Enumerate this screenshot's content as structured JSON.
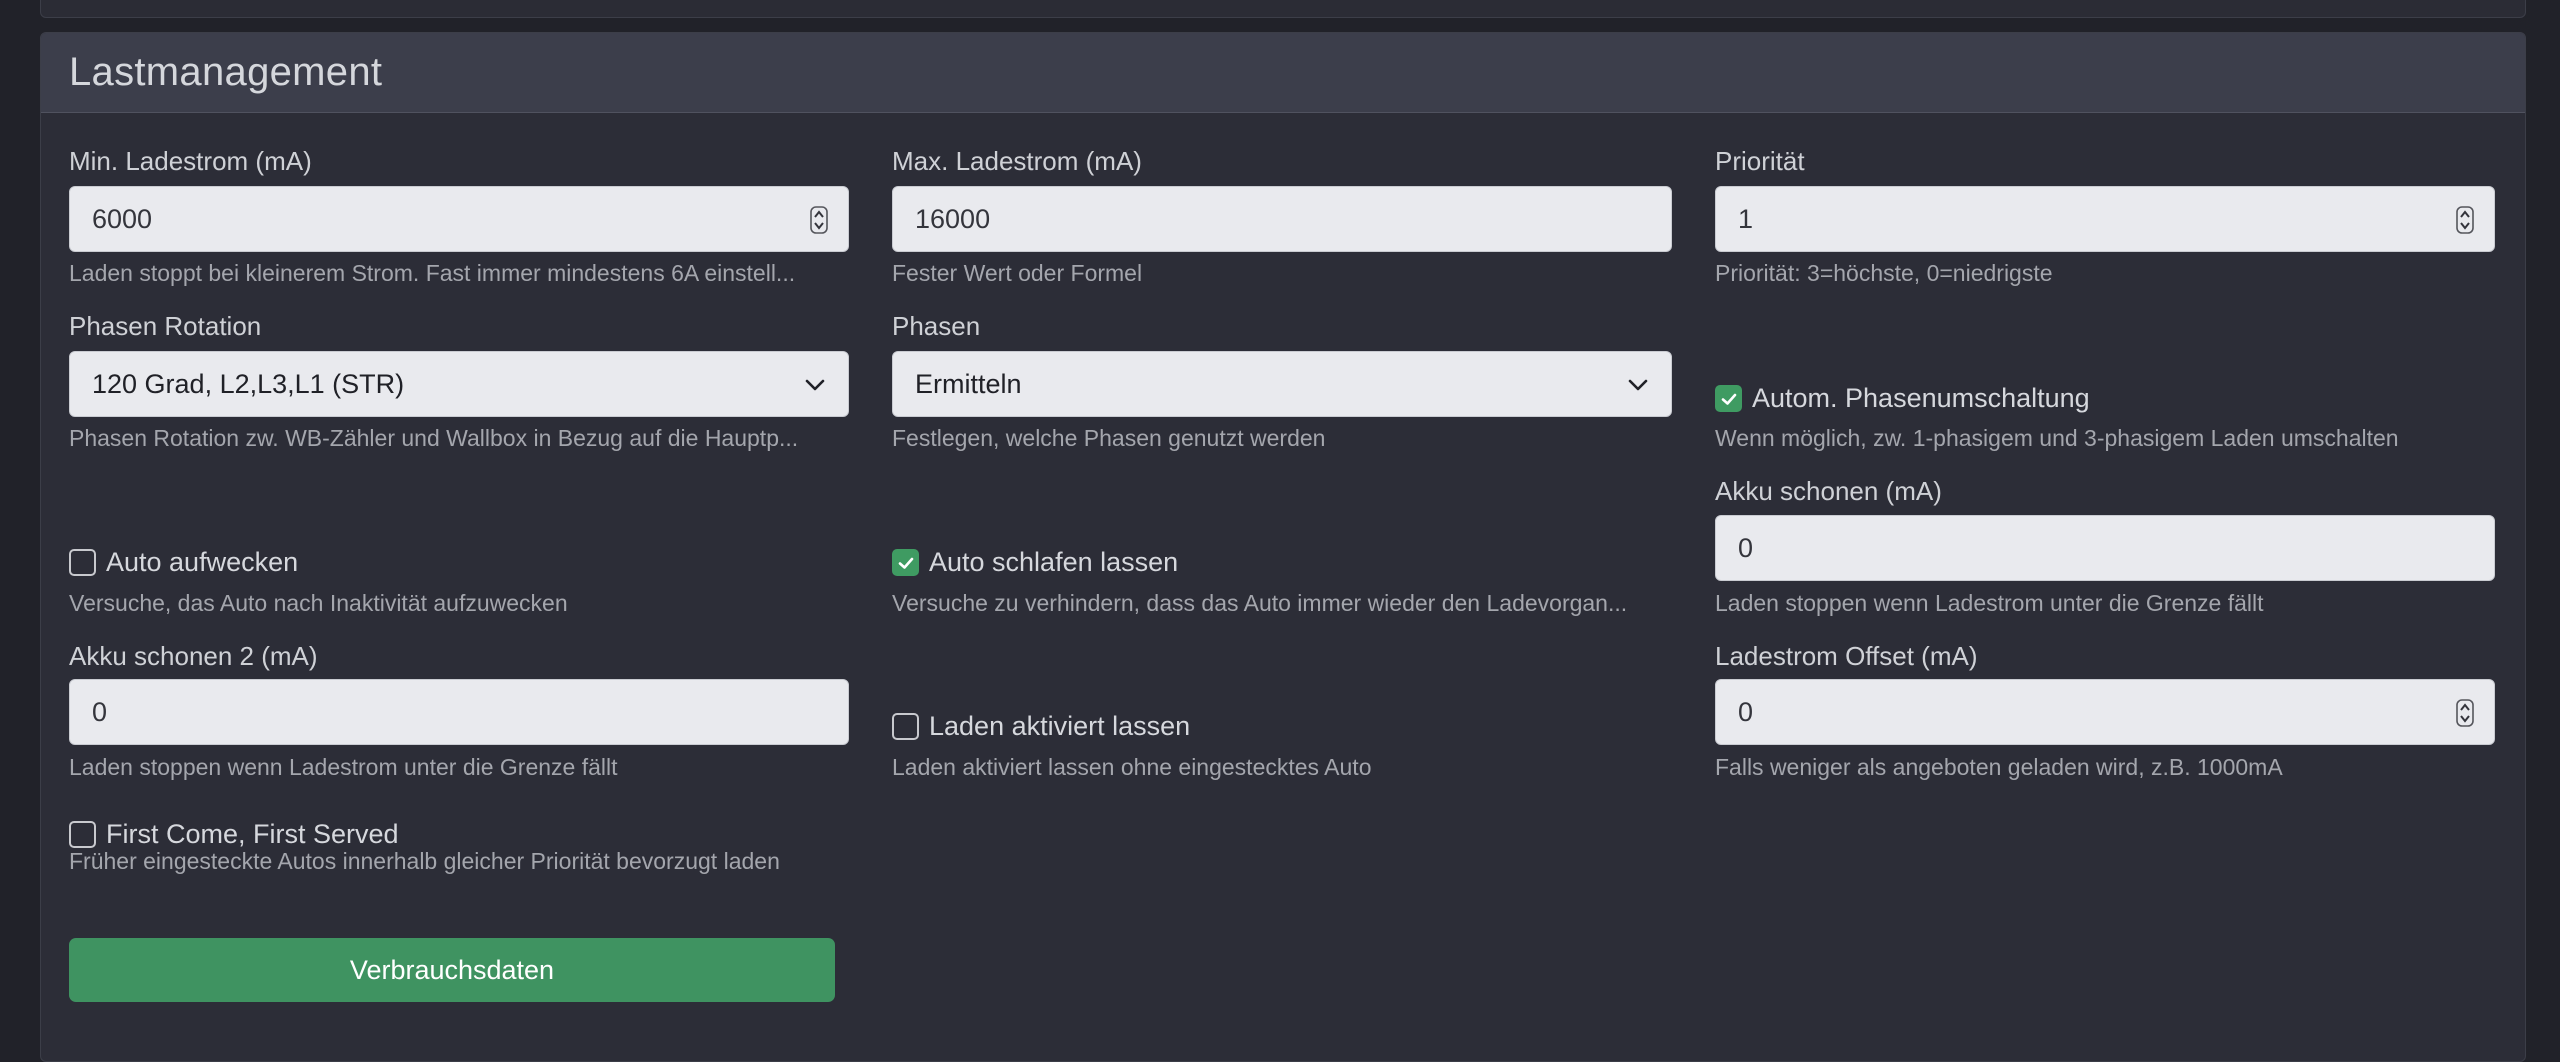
{
  "card": {
    "title": "Lastmanagement"
  },
  "fields": {
    "min_ladestrom": {
      "label": "Min. Ladestrom (mA)",
      "value": "6000",
      "help": "Laden stoppt bei kleinerem Strom. Fast immer mindestens 6A einstell..."
    },
    "max_ladestrom": {
      "label": "Max. Ladestrom (mA)",
      "value": "16000",
      "help": "Fester Wert oder Formel"
    },
    "prioritaet": {
      "label": "Priorität",
      "value": "1",
      "help": "Priorität: 3=höchste, 0=niedrigste"
    },
    "phasen_rotation": {
      "label": "Phasen Rotation",
      "value": "120 Grad, L2,L3,L1 (STR)",
      "help": "Phasen Rotation zw. WB-Zähler und Wallbox in Bezug auf die Hauptp..."
    },
    "phasen": {
      "label": "Phasen",
      "value": "Ermitteln",
      "help": "Festlegen, welche Phasen genutzt werden"
    },
    "akku_schonen": {
      "label": "Akku schonen (mA)",
      "value": "0",
      "help": "Laden stoppen wenn Ladestrom unter die Grenze fällt"
    },
    "akku_schonen_2": {
      "label": "Akku schonen 2 (mA)",
      "value": "0",
      "help": "Laden stoppen wenn Ladestrom unter die Grenze fällt"
    },
    "ladestrom_offset": {
      "label": "Ladestrom Offset (mA)",
      "value": "0",
      "help": "Falls weniger als angeboten geladen wird, z.B. 1000mA"
    }
  },
  "checkboxes": {
    "autom_phasenumschaltung": {
      "label": "Autom. Phasenumschaltung",
      "checked": true,
      "help": "Wenn möglich, zw. 1-phasigem und 3-phasigem Laden umschalten"
    },
    "auto_aufwecken": {
      "label": "Auto aufwecken",
      "checked": false,
      "help": "Versuche, das Auto nach Inaktivität aufzuwecken"
    },
    "auto_schlafen": {
      "label": "Auto schlafen lassen",
      "checked": true,
      "help": "Versuche zu verhindern, dass das Auto immer wieder den Ladevorgan..."
    },
    "laden_aktiviert": {
      "label": "Laden aktiviert lassen",
      "checked": false,
      "help": "Laden aktiviert lassen ohne eingestecktes Auto"
    },
    "first_come": {
      "label": "First Come, First Served",
      "checked": false,
      "help": "Früher eingesteckte Autos innerhalb gleicher Priorität bevorzugt laden"
    }
  },
  "button": {
    "label": "Verbrauchsdaten"
  },
  "icons": {
    "spinner": "spinner-arrows-icon",
    "chevron": "chevron-down-icon",
    "check": "check-icon"
  },
  "colors": {
    "accent_green": "#3f9361",
    "background": "#212229",
    "card": "#2c2d37",
    "header": "#3c3e4b"
  }
}
